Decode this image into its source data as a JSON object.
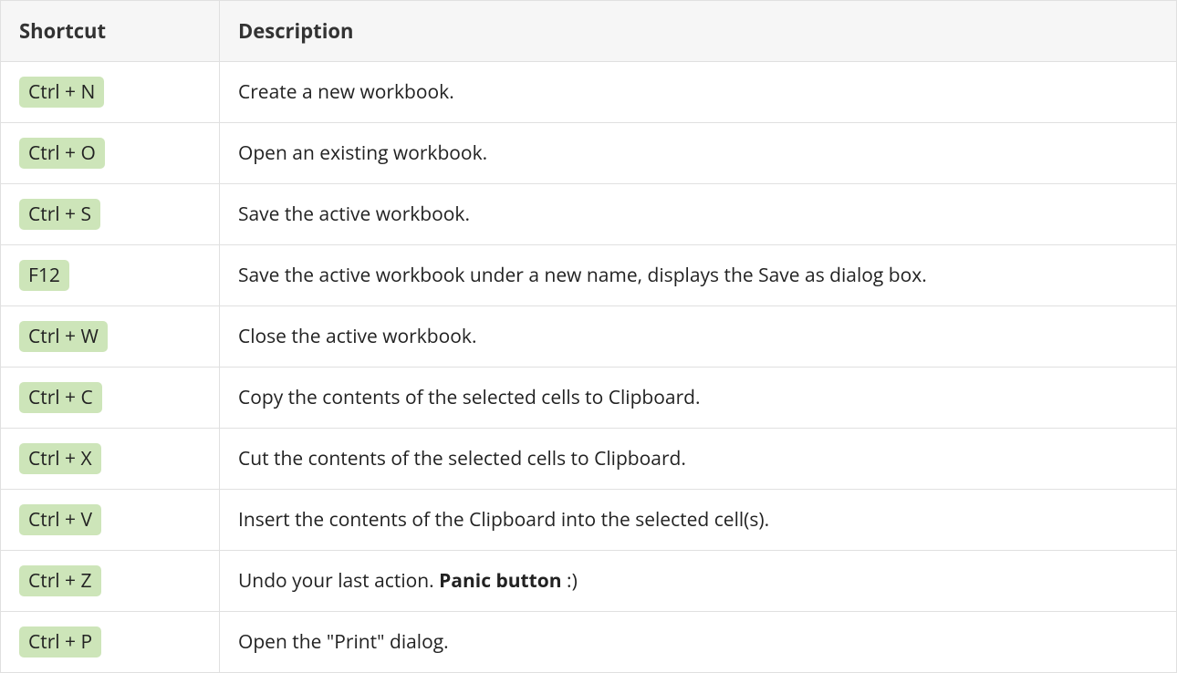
{
  "headers": {
    "shortcut": "Shortcut",
    "description": "Description"
  },
  "rows": [
    {
      "shortcut": "Ctrl + N",
      "description_parts": [
        {
          "text": "Create a new workbook.",
          "bold": false
        }
      ]
    },
    {
      "shortcut": "Ctrl + O",
      "description_parts": [
        {
          "text": "Open an existing workbook.",
          "bold": false
        }
      ]
    },
    {
      "shortcut": "Ctrl + S",
      "description_parts": [
        {
          "text": "Save the active workbook.",
          "bold": false
        }
      ]
    },
    {
      "shortcut": "F12",
      "description_parts": [
        {
          "text": "Save the active workbook under a new name, displays the Save as dialog box.",
          "bold": false
        }
      ]
    },
    {
      "shortcut": "Ctrl + W",
      "description_parts": [
        {
          "text": "Close the active workbook.",
          "bold": false
        }
      ]
    },
    {
      "shortcut": "Ctrl + C",
      "description_parts": [
        {
          "text": "Copy the contents of the selected cells to Clipboard.",
          "bold": false
        }
      ]
    },
    {
      "shortcut": "Ctrl + X",
      "description_parts": [
        {
          "text": "Cut the contents of the selected cells to Clipboard.",
          "bold": false
        }
      ]
    },
    {
      "shortcut": "Ctrl + V",
      "description_parts": [
        {
          "text": "Insert the contents of the Clipboard into the selected cell(s).",
          "bold": false
        }
      ]
    },
    {
      "shortcut": "Ctrl + Z",
      "description_parts": [
        {
          "text": "Undo your last action. ",
          "bold": false
        },
        {
          "text": "Panic button",
          "bold": true
        },
        {
          "text": " :)",
          "bold": false
        }
      ]
    },
    {
      "shortcut": "Ctrl + P",
      "description_parts": [
        {
          "text": "Open the \"Print\" dialog.",
          "bold": false
        }
      ]
    }
  ]
}
